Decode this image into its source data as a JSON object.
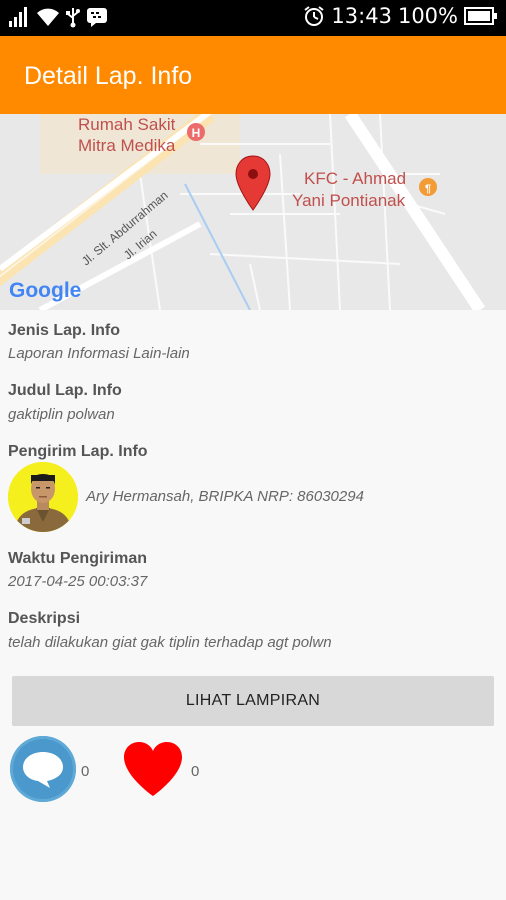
{
  "status_bar": {
    "time": "13:43",
    "battery": "100%",
    "icons": [
      "signal-icon",
      "wifi-icon",
      "usb-icon",
      "bbm-icon",
      "alarm-icon",
      "battery-icon"
    ]
  },
  "app_bar": {
    "title": "Detail Lap. Info",
    "color": "#ff8a00"
  },
  "map": {
    "labels": {
      "hospital_line1": "Rumah Sakit",
      "hospital_line2": "Mitra Medika",
      "kfc_line1": "KFC - Ahmad",
      "kfc_line2": "Yani Pontianak",
      "street1": "Jl. Slt. Abdurrahman",
      "street2": "Jl. Irian",
      "logo": "Google"
    }
  },
  "details": {
    "jenis": {
      "label": "Jenis Lap. Info",
      "value": "Laporan Informasi Lain-lain"
    },
    "judul": {
      "label": "Judul Lap. Info",
      "value": "gaktiplin polwan"
    },
    "pengirim": {
      "label": "Pengirim Lap. Info",
      "value": "Ary Hermansah, BRIPKA NRP: 86030294"
    },
    "waktu": {
      "label": "Waktu Pengiriman",
      "value": "2017-04-25 00:03:37"
    },
    "deskripsi": {
      "label": "Deskripsi",
      "value": "telah dilakukan giat gak tiplin terhadap agt polwn"
    }
  },
  "actions": {
    "lampiran_label": "LIHAT LAMPIRAN",
    "comment_count": "0",
    "like_count": "0",
    "comment_color": "#5ea9d6",
    "like_color": "#ff0000"
  }
}
